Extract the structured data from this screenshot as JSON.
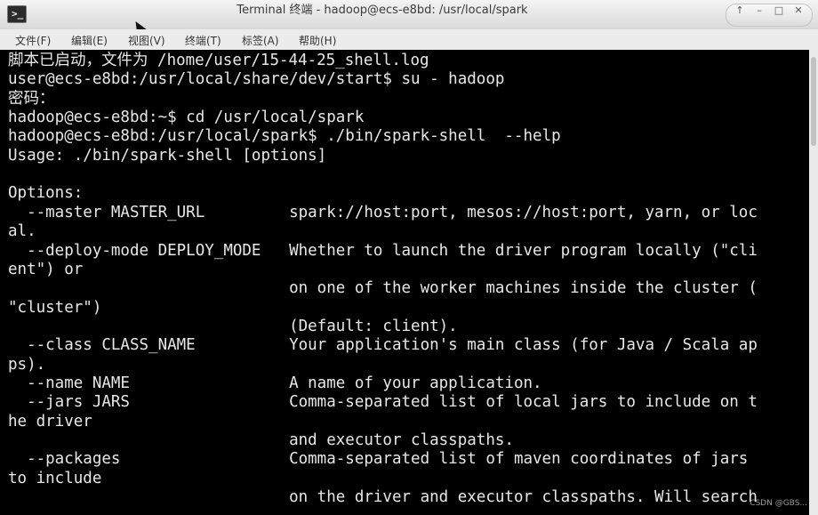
{
  "window": {
    "title": "Terminal 终端 - hadoop@ecs-e8bd: /usr/local/spark",
    "app_icon_glyph": ">_",
    "controls": [
      "up-arrow-icon",
      "minimize-icon",
      "maximize-icon",
      "close-icon"
    ]
  },
  "menu": {
    "items": [
      "文件(F)",
      "编辑(E)",
      "视图(V)",
      "终端(T)",
      "标签(A)",
      "帮助(H)"
    ]
  },
  "terminal": {
    "lines": [
      "脚本已启动，文件为 /home/user/15-44-25_shell.log",
      "user@ecs-e8bd:/usr/local/share/dev/start$ su - hadoop",
      "密码：",
      "hadoop@ecs-e8bd:~$ cd /usr/local/spark",
      "hadoop@ecs-e8bd:/usr/local/spark$ ./bin/spark-shell  --help",
      "Usage: ./bin/spark-shell [options]",
      "",
      "Options:",
      "  --master MASTER_URL         spark://host:port, mesos://host:port, yarn, or loc",
      "al.",
      "  --deploy-mode DEPLOY_MODE   Whether to launch the driver program locally (\"cli",
      "ent\") or",
      "                              on one of the worker machines inside the cluster (",
      "\"cluster\")",
      "                              (Default: client).",
      "  --class CLASS_NAME          Your application's main class (for Java / Scala ap",
      "ps).",
      "  --name NAME                 A name of your application.",
      "  --jars JARS                 Comma-separated list of local jars to include on t",
      "he driver",
      "                              and executor classpaths.",
      "  --packages                  Comma-separated list of maven coordinates of jars",
      "to include",
      "                              on the driver and executor classpaths. Will search"
    ]
  },
  "watermark": "CSDN @GBS..."
}
